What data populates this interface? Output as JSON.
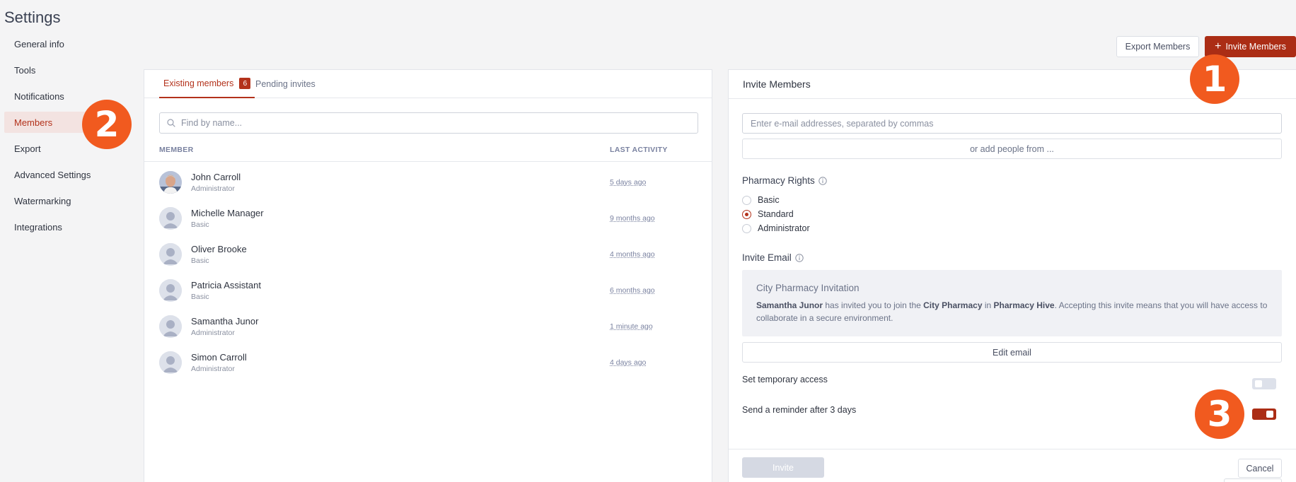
{
  "page": {
    "title": "Settings"
  },
  "sidebar": {
    "items": [
      {
        "label": "General info"
      },
      {
        "label": "Tools"
      },
      {
        "label": "Notifications"
      },
      {
        "label": "Members"
      },
      {
        "label": "Export"
      },
      {
        "label": "Advanced Settings"
      },
      {
        "label": "Watermarking"
      },
      {
        "label": "Integrations"
      }
    ],
    "active": "Members"
  },
  "header": {
    "export_label": "Export Members",
    "invite_label": "Invite Members",
    "invite_icon": "plus-icon"
  },
  "members_panel": {
    "tab_existing": "Existing members",
    "tab_existing_count": "6",
    "tab_pending": "Pending invites",
    "search_placeholder": "Find by name...",
    "col_member": "MEMBER",
    "col_activity": "LAST ACTIVITY",
    "members": [
      {
        "name": "John Carroll",
        "role": "Administrator",
        "activity": "5 days ago",
        "avatar": "photo"
      },
      {
        "name": "Michelle Manager",
        "role": "Basic",
        "activity": "9 months ago",
        "avatar": "placeholder"
      },
      {
        "name": "Oliver Brooke",
        "role": "Basic",
        "activity": "4 months ago",
        "avatar": "placeholder"
      },
      {
        "name": "Patricia Assistant",
        "role": "Basic",
        "activity": "6 months ago",
        "avatar": "placeholder"
      },
      {
        "name": "Samantha Junor",
        "role": "Administrator",
        "activity": "1 minute ago",
        "avatar": "placeholder"
      },
      {
        "name": "Simon Carroll",
        "role": "Administrator",
        "activity": "4 days ago",
        "avatar": "placeholder"
      }
    ]
  },
  "invite_panel": {
    "title": "Invite Members",
    "email_placeholder": "Enter e-mail addresses, separated by commas",
    "add_people_label": "or add people from ...",
    "rights_label": "Pharmacy Rights",
    "rights_options": [
      {
        "label": "Basic",
        "checked": false
      },
      {
        "label": "Standard",
        "checked": true
      },
      {
        "label": "Administrator",
        "checked": false
      }
    ],
    "invite_email_label": "Invite Email",
    "preview": {
      "title": "City Pharmacy Invitation",
      "inviter": "Samantha Junor",
      "text_1": " has invited you to join the ",
      "org": "City Pharmacy",
      "text_2": " in ",
      "app": "Pharmacy Hive",
      "text_3": ". Accepting this invite means that you will have access to collaborate in a secure environment."
    },
    "edit_email_label": "Edit email",
    "temporary_access_label": "Set temporary access",
    "temporary_access_on": false,
    "reminder_label": "Send a reminder after 3 days",
    "reminder_on": true,
    "invite_button": "Invite",
    "cancel_button": "Cancel"
  },
  "step_markers": [
    "1",
    "2",
    "3"
  ],
  "colors": {
    "accent": "#ab2d15",
    "marker": "#f15a1f",
    "active_bg": "#f3e3e1"
  }
}
